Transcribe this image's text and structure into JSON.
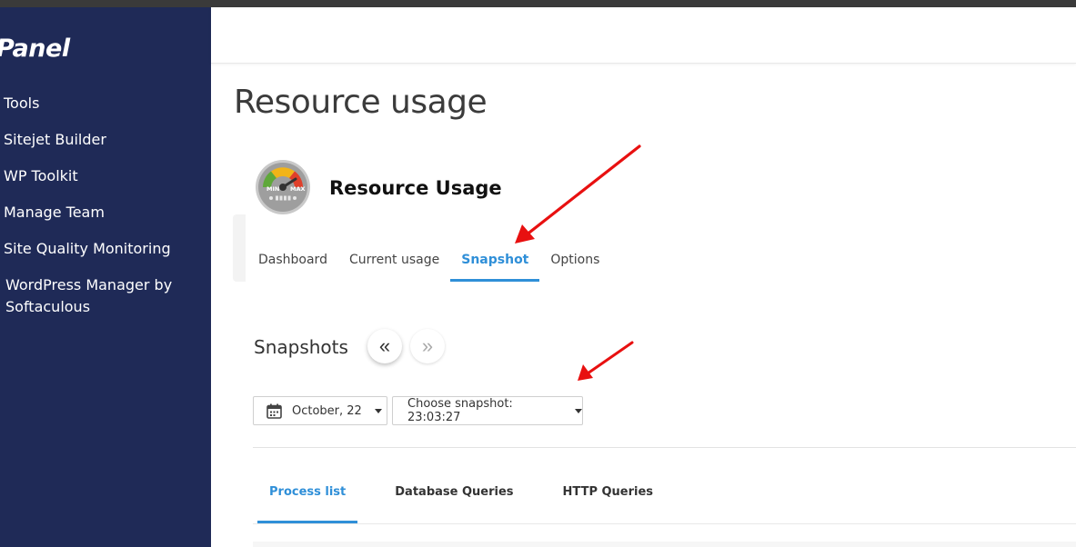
{
  "brand": {
    "logo_text": "Panel"
  },
  "sidebar": {
    "items": [
      {
        "label": "Tools"
      },
      {
        "label": "Sitejet Builder"
      },
      {
        "label": "WP Toolkit"
      },
      {
        "label": "Manage Team"
      },
      {
        "label": "Site Quality Monitoring"
      },
      {
        "label": "WordPress Manager by Softaculous"
      }
    ]
  },
  "page": {
    "title": "Resource usage"
  },
  "app": {
    "title": "Resource Usage",
    "icon": "gauge-icon",
    "icon_min": "MIN",
    "icon_max": "MAX"
  },
  "tabs": [
    {
      "label": "Dashboard",
      "active": false
    },
    {
      "label": "Current usage",
      "active": false
    },
    {
      "label": "Snapshot",
      "active": true
    },
    {
      "label": "Options",
      "active": false
    }
  ],
  "snapshots": {
    "title": "Snapshots",
    "prev_icon": "«",
    "next_icon": "»",
    "date_value": "October, 22",
    "snapshot_select": "Choose snapshot: 23:03:27"
  },
  "subtabs": [
    {
      "label": "Process list",
      "active": true
    },
    {
      "label": "Database Queries",
      "active": false
    },
    {
      "label": "HTTP Queries",
      "active": false
    }
  ],
  "colors": {
    "sidebar_bg": "#1f2a57",
    "accent": "#2f8fd8",
    "annotation_arrow": "#e81010"
  }
}
